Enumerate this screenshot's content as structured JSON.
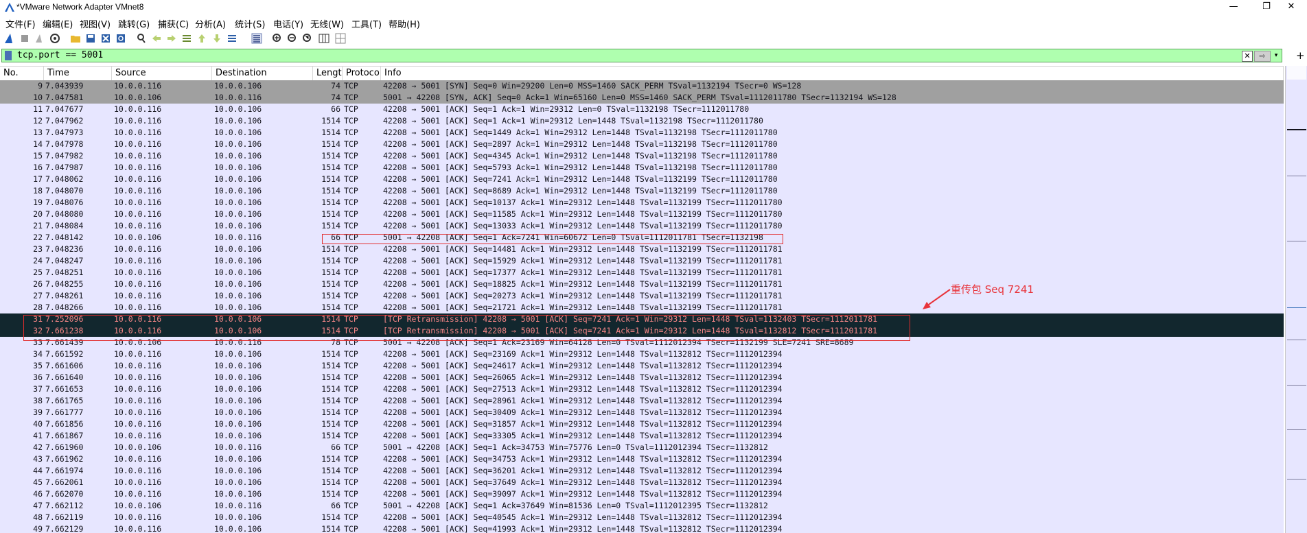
{
  "window": {
    "title": "*VMware Network Adapter VMnet8",
    "controls": [
      "—",
      "❐",
      "✕"
    ]
  },
  "menu": [
    "文件(F)",
    "编辑(E)",
    "视图(V)",
    "跳转(G)",
    "捕获(C)",
    "分析(A)",
    "统计(S)",
    "电话(Y)",
    "无线(W)",
    "工具(T)",
    "帮助(H)"
  ],
  "toolbar": {
    "icons": [
      "shark-fin-start-icon",
      "stop-icon",
      "restart-icon",
      "capture-options-icon",
      "open-file-icon",
      "save-file-icon",
      "close-file-icon",
      "reload-icon",
      "find-packet-icon",
      "go-back-icon",
      "go-forward-icon",
      "go-to-packet-icon",
      "first-packet-icon",
      "last-packet-icon",
      "autoscroll-icon",
      "colorize-icon",
      "zoom-in-icon",
      "zoom-out-icon",
      "normal-size-icon",
      "resize-columns-icon",
      "layout-icon"
    ]
  },
  "filter": {
    "value": "tcp.port == 5001",
    "apply_label": "⇨",
    "clear_label": "✕",
    "dropdown_label": "▾",
    "add_label": "+"
  },
  "columns": [
    "No.",
    "Time",
    "Source",
    "Destination",
    "Lengt",
    "Protoco",
    "Info"
  ],
  "packets": [
    {
      "no": "9",
      "time": "7.043939",
      "src": "10.0.0.116",
      "dst": "10.0.0.106",
      "len": "74",
      "proto": "TCP",
      "info": "42208 → 5001 [SYN] Seq=0 Win=29200 Len=0 MSS=1460 SACK_PERM TSval=1132194 TSecr=0 WS=128",
      "style": "syn"
    },
    {
      "no": "10",
      "time": "7.047581",
      "src": "10.0.0.106",
      "dst": "10.0.0.116",
      "len": "74",
      "proto": "TCP",
      "info": "5001 → 42208 [SYN, ACK] Seq=0 Ack=1 Win=65160 Len=0 MSS=1460 SACK_PERM TSval=1112011780 TSecr=1132194 WS=128",
      "style": "syn"
    },
    {
      "no": "11",
      "time": "7.047677",
      "src": "10.0.0.116",
      "dst": "10.0.0.106",
      "len": "66",
      "proto": "TCP",
      "info": "42208 → 5001 [ACK] Seq=1 Ack=1 Win=29312 Len=0 TSval=1132198 TSecr=1112011780",
      "style": ""
    },
    {
      "no": "12",
      "time": "7.047962",
      "src": "10.0.0.116",
      "dst": "10.0.0.106",
      "len": "1514",
      "proto": "TCP",
      "info": "42208 → 5001 [ACK] Seq=1 Ack=1 Win=29312 Len=1448 TSval=1132198 TSecr=1112011780",
      "style": ""
    },
    {
      "no": "13",
      "time": "7.047973",
      "src": "10.0.0.116",
      "dst": "10.0.0.106",
      "len": "1514",
      "proto": "TCP",
      "info": "42208 → 5001 [ACK] Seq=1449 Ack=1 Win=29312 Len=1448 TSval=1132198 TSecr=1112011780",
      "style": ""
    },
    {
      "no": "14",
      "time": "7.047978",
      "src": "10.0.0.116",
      "dst": "10.0.0.106",
      "len": "1514",
      "proto": "TCP",
      "info": "42208 → 5001 [ACK] Seq=2897 Ack=1 Win=29312 Len=1448 TSval=1132198 TSecr=1112011780",
      "style": ""
    },
    {
      "no": "15",
      "time": "7.047982",
      "src": "10.0.0.116",
      "dst": "10.0.0.106",
      "len": "1514",
      "proto": "TCP",
      "info": "42208 → 5001 [ACK] Seq=4345 Ack=1 Win=29312 Len=1448 TSval=1132198 TSecr=1112011780",
      "style": ""
    },
    {
      "no": "16",
      "time": "7.047987",
      "src": "10.0.0.116",
      "dst": "10.0.0.106",
      "len": "1514",
      "proto": "TCP",
      "info": "42208 → 5001 [ACK] Seq=5793 Ack=1 Win=29312 Len=1448 TSval=1132198 TSecr=1112011780",
      "style": ""
    },
    {
      "no": "17",
      "time": "7.048062",
      "src": "10.0.0.116",
      "dst": "10.0.0.106",
      "len": "1514",
      "proto": "TCP",
      "info": "42208 → 5001 [ACK] Seq=7241 Ack=1 Win=29312 Len=1448 TSval=1132199 TSecr=1112011780",
      "style": ""
    },
    {
      "no": "18",
      "time": "7.048070",
      "src": "10.0.0.116",
      "dst": "10.0.0.106",
      "len": "1514",
      "proto": "TCP",
      "info": "42208 → 5001 [ACK] Seq=8689 Ack=1 Win=29312 Len=1448 TSval=1132199 TSecr=1112011780",
      "style": ""
    },
    {
      "no": "19",
      "time": "7.048076",
      "src": "10.0.0.116",
      "dst": "10.0.0.106",
      "len": "1514",
      "proto": "TCP",
      "info": "42208 → 5001 [ACK] Seq=10137 Ack=1 Win=29312 Len=1448 TSval=1132199 TSecr=1112011780",
      "style": ""
    },
    {
      "no": "20",
      "time": "7.048080",
      "src": "10.0.0.116",
      "dst": "10.0.0.106",
      "len": "1514",
      "proto": "TCP",
      "info": "42208 → 5001 [ACK] Seq=11585 Ack=1 Win=29312 Len=1448 TSval=1132199 TSecr=1112011780",
      "style": ""
    },
    {
      "no": "21",
      "time": "7.048084",
      "src": "10.0.0.116",
      "dst": "10.0.0.106",
      "len": "1514",
      "proto": "TCP",
      "info": "42208 → 5001 [ACK] Seq=13033 Ack=1 Win=29312 Len=1448 TSval=1132199 TSecr=1112011780",
      "style": ""
    },
    {
      "no": "22",
      "time": "7.048142",
      "src": "10.0.0.106",
      "dst": "10.0.0.116",
      "len": "66",
      "proto": "TCP",
      "info": "5001 → 42208 [ACK] Seq=1 Ack=7241 Win=60672 Len=0 TSval=1112011781 TSecr=1132198",
      "style": ""
    },
    {
      "no": "23",
      "time": "7.048236",
      "src": "10.0.0.116",
      "dst": "10.0.0.106",
      "len": "1514",
      "proto": "TCP",
      "info": "42208 → 5001 [ACK] Seq=14481 Ack=1 Win=29312 Len=1448 TSval=1132199 TSecr=1112011781",
      "style": ""
    },
    {
      "no": "24",
      "time": "7.048247",
      "src": "10.0.0.116",
      "dst": "10.0.0.106",
      "len": "1514",
      "proto": "TCP",
      "info": "42208 → 5001 [ACK] Seq=15929 Ack=1 Win=29312 Len=1448 TSval=1132199 TSecr=1112011781",
      "style": ""
    },
    {
      "no": "25",
      "time": "7.048251",
      "src": "10.0.0.116",
      "dst": "10.0.0.106",
      "len": "1514",
      "proto": "TCP",
      "info": "42208 → 5001 [ACK] Seq=17377 Ack=1 Win=29312 Len=1448 TSval=1132199 TSecr=1112011781",
      "style": ""
    },
    {
      "no": "26",
      "time": "7.048255",
      "src": "10.0.0.116",
      "dst": "10.0.0.106",
      "len": "1514",
      "proto": "TCP",
      "info": "42208 → 5001 [ACK] Seq=18825 Ack=1 Win=29312 Len=1448 TSval=1132199 TSecr=1112011781",
      "style": ""
    },
    {
      "no": "27",
      "time": "7.048261",
      "src": "10.0.0.116",
      "dst": "10.0.0.106",
      "len": "1514",
      "proto": "TCP",
      "info": "42208 → 5001 [ACK] Seq=20273 Ack=1 Win=29312 Len=1448 TSval=1132199 TSecr=1112011781",
      "style": ""
    },
    {
      "no": "28",
      "time": "7.048266",
      "src": "10.0.0.116",
      "dst": "10.0.0.106",
      "len": "1514",
      "proto": "TCP",
      "info": "42208 → 5001 [ACK] Seq=21721 Ack=1 Win=29312 Len=1448 TSval=1132199 TSecr=1112011781",
      "style": ""
    },
    {
      "no": "31",
      "time": "7.252096",
      "src": "10.0.0.116",
      "dst": "10.0.0.106",
      "len": "1514",
      "proto": "TCP",
      "info": "[TCP Retransmission] 42208 → 5001 [ACK] Seq=7241 Ack=1 Win=29312 Len=1448 TSval=1132403 TSecr=1112011781",
      "style": "retrans"
    },
    {
      "no": "32",
      "time": "7.661238",
      "src": "10.0.0.116",
      "dst": "10.0.0.106",
      "len": "1514",
      "proto": "TCP",
      "info": "[TCP Retransmission] 42208 → 5001 [ACK] Seq=7241 Ack=1 Win=29312 Len=1448 TSval=1132812 TSecr=1112011781",
      "style": "retrans"
    },
    {
      "no": "33",
      "time": "7.661439",
      "src": "10.0.0.106",
      "dst": "10.0.0.116",
      "len": "78",
      "proto": "TCP",
      "info": "5001 → 42208 [ACK] Seq=1 Ack=23169 Win=64128 Len=0 TSval=1112012394 TSecr=1132199 SLE=7241 SRE=8689",
      "style": ""
    },
    {
      "no": "34",
      "time": "7.661592",
      "src": "10.0.0.116",
      "dst": "10.0.0.106",
      "len": "1514",
      "proto": "TCP",
      "info": "42208 → 5001 [ACK] Seq=23169 Ack=1 Win=29312 Len=1448 TSval=1132812 TSecr=1112012394",
      "style": ""
    },
    {
      "no": "35",
      "time": "7.661606",
      "src": "10.0.0.116",
      "dst": "10.0.0.106",
      "len": "1514",
      "proto": "TCP",
      "info": "42208 → 5001 [ACK] Seq=24617 Ack=1 Win=29312 Len=1448 TSval=1132812 TSecr=1112012394",
      "style": ""
    },
    {
      "no": "36",
      "time": "7.661640",
      "src": "10.0.0.116",
      "dst": "10.0.0.106",
      "len": "1514",
      "proto": "TCP",
      "info": "42208 → 5001 [ACK] Seq=26065 Ack=1 Win=29312 Len=1448 TSval=1132812 TSecr=1112012394",
      "style": ""
    },
    {
      "no": "37",
      "time": "7.661653",
      "src": "10.0.0.116",
      "dst": "10.0.0.106",
      "len": "1514",
      "proto": "TCP",
      "info": "42208 → 5001 [ACK] Seq=27513 Ack=1 Win=29312 Len=1448 TSval=1132812 TSecr=1112012394",
      "style": ""
    },
    {
      "no": "38",
      "time": "7.661765",
      "src": "10.0.0.116",
      "dst": "10.0.0.106",
      "len": "1514",
      "proto": "TCP",
      "info": "42208 → 5001 [ACK] Seq=28961 Ack=1 Win=29312 Len=1448 TSval=1132812 TSecr=1112012394",
      "style": ""
    },
    {
      "no": "39",
      "time": "7.661777",
      "src": "10.0.0.116",
      "dst": "10.0.0.106",
      "len": "1514",
      "proto": "TCP",
      "info": "42208 → 5001 [ACK] Seq=30409 Ack=1 Win=29312 Len=1448 TSval=1132812 TSecr=1112012394",
      "style": ""
    },
    {
      "no": "40",
      "time": "7.661856",
      "src": "10.0.0.116",
      "dst": "10.0.0.106",
      "len": "1514",
      "proto": "TCP",
      "info": "42208 → 5001 [ACK] Seq=31857 Ack=1 Win=29312 Len=1448 TSval=1132812 TSecr=1112012394",
      "style": ""
    },
    {
      "no": "41",
      "time": "7.661867",
      "src": "10.0.0.116",
      "dst": "10.0.0.106",
      "len": "1514",
      "proto": "TCP",
      "info": "42208 → 5001 [ACK] Seq=33305 Ack=1 Win=29312 Len=1448 TSval=1132812 TSecr=1112012394",
      "style": ""
    },
    {
      "no": "42",
      "time": "7.661960",
      "src": "10.0.0.106",
      "dst": "10.0.0.116",
      "len": "66",
      "proto": "TCP",
      "info": "5001 → 42208 [ACK] Seq=1 Ack=34753 Win=75776 Len=0 TSval=1112012394 TSecr=1132812",
      "style": ""
    },
    {
      "no": "43",
      "time": "7.661962",
      "src": "10.0.0.116",
      "dst": "10.0.0.106",
      "len": "1514",
      "proto": "TCP",
      "info": "42208 → 5001 [ACK] Seq=34753 Ack=1 Win=29312 Len=1448 TSval=1132812 TSecr=1112012394",
      "style": ""
    },
    {
      "no": "44",
      "time": "7.661974",
      "src": "10.0.0.116",
      "dst": "10.0.0.106",
      "len": "1514",
      "proto": "TCP",
      "info": "42208 → 5001 [ACK] Seq=36201 Ack=1 Win=29312 Len=1448 TSval=1132812 TSecr=1112012394",
      "style": ""
    },
    {
      "no": "45",
      "time": "7.662061",
      "src": "10.0.0.116",
      "dst": "10.0.0.106",
      "len": "1514",
      "proto": "TCP",
      "info": "42208 → 5001 [ACK] Seq=37649 Ack=1 Win=29312 Len=1448 TSval=1132812 TSecr=1112012394",
      "style": ""
    },
    {
      "no": "46",
      "time": "7.662070",
      "src": "10.0.0.116",
      "dst": "10.0.0.106",
      "len": "1514",
      "proto": "TCP",
      "info": "42208 → 5001 [ACK] Seq=39097 Ack=1 Win=29312 Len=1448 TSval=1132812 TSecr=1112012394",
      "style": ""
    },
    {
      "no": "47",
      "time": "7.662112",
      "src": "10.0.0.106",
      "dst": "10.0.0.116",
      "len": "66",
      "proto": "TCP",
      "info": "5001 → 42208 [ACK] Seq=1 Ack=37649 Win=81536 Len=0 TSval=1112012395 TSecr=1132812",
      "style": ""
    },
    {
      "no": "48",
      "time": "7.662119",
      "src": "10.0.0.116",
      "dst": "10.0.0.106",
      "len": "1514",
      "proto": "TCP",
      "info": "42208 → 5001 [ACK] Seq=40545 Ack=1 Win=29312 Len=1448 TSval=1132812 TSecr=1112012394",
      "style": ""
    },
    {
      "no": "49",
      "time": "7.662129",
      "src": "10.0.0.116",
      "dst": "10.0.0.106",
      "len": "1514",
      "proto": "TCP",
      "info": "42208 → 5001 [ACK] Seq=41993 Ack=1 Win=29312 Len=1448 TSval=1132812 TSecr=1112012394",
      "style": ""
    }
  ],
  "annotation": {
    "text": "重传包  Seq 7241",
    "color": "#e32d2d"
  },
  "colors": {
    "filter_valid_bg": "#afffaf",
    "row_tcp_bg": "#e7e6ff",
    "row_syn_bg": "#a0a0a0",
    "row_retrans_bg": "#12272e",
    "row_retrans_fg": "#f78787"
  }
}
